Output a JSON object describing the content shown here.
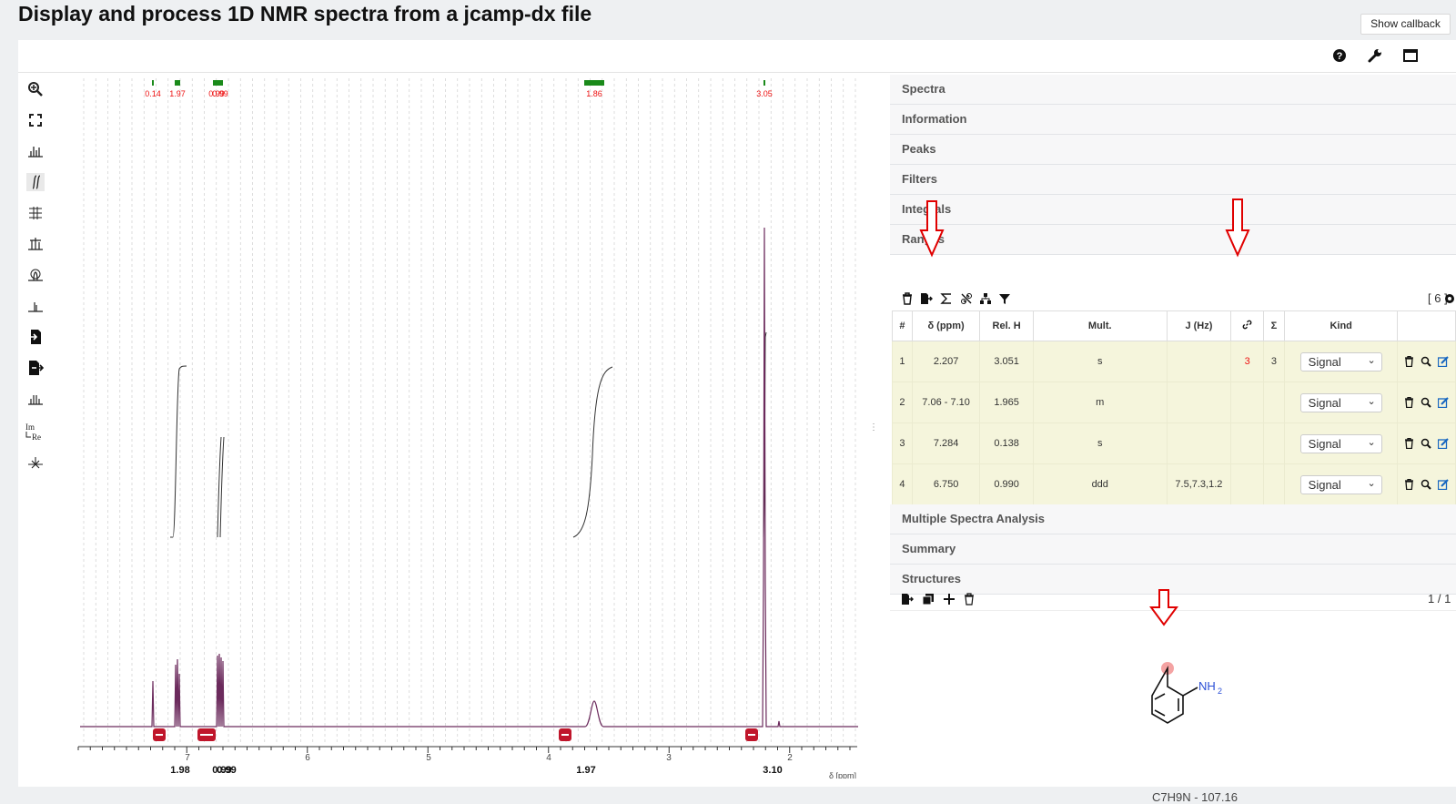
{
  "page": {
    "title": "Display and process 1D NMR spectra from a jcamp-dx file",
    "show_callback_label": "Show callback"
  },
  "topbar": {
    "icons": [
      "help-icon",
      "wrench-icon",
      "fullscreen-icon"
    ]
  },
  "toolbar": {
    "tools": [
      "zoom-tool",
      "full-zoom-tool",
      "peak-picking-tool",
      "integral-tool",
      "zone-tool",
      "ranges-picking-tool",
      "phase-correction-tool",
      "baseline-correction-tool",
      "import-tool",
      "export-tool",
      "multiplet-analysis-tool",
      "real-imaginary-tool",
      "exclusion-zones-tool"
    ]
  },
  "spectrum": {
    "x_axis_unit": "δ [ppm]",
    "ticks": [
      "7",
      "6",
      "5",
      "4",
      "3",
      "2"
    ],
    "integral_labels": [
      "0.14",
      "1.97",
      "0.99",
      "1.86",
      "3.05"
    ],
    "range_sums": [
      "1.98",
      "0.99",
      "1.97",
      "3.10"
    ]
  },
  "panels": {
    "spectra": "Spectra",
    "information": "Information",
    "peaks": "Peaks",
    "filters": "Filters",
    "integrals": "Integrals",
    "ranges": "Ranges",
    "multiple": "Multiple Spectra Analysis",
    "summary": "Summary",
    "structures": "Structures"
  },
  "ranges": {
    "count_label": "[ 6 ]",
    "columns": [
      "#",
      "δ (ppm)",
      "Rel. H",
      "Mult.",
      "J (Hz)",
      "link-icon",
      "Σ",
      "Kind"
    ],
    "rows": [
      {
        "index": "1",
        "delta": "2.207",
        "rel_h": "3.051",
        "mult": "s",
        "j": "",
        "link": "3",
        "sum": "3",
        "kind": "Signal"
      },
      {
        "index": "2",
        "delta": "7.06 - 7.10",
        "rel_h": "1.965",
        "mult": "m",
        "j": "",
        "link": "",
        "sum": "",
        "kind": "Signal"
      },
      {
        "index": "3",
        "delta": "7.284",
        "rel_h": "0.138",
        "mult": "s",
        "j": "",
        "link": "",
        "sum": "",
        "kind": "Signal"
      },
      {
        "index": "4",
        "delta": "6.750",
        "rel_h": "0.990",
        "mult": "ddd",
        "j": "7.5,7.3,1.2",
        "link": "",
        "sum": "",
        "kind": "Signal"
      }
    ]
  },
  "structures": {
    "pager": "1 / 1",
    "nh2_label": "NH",
    "nh2_sub": "2",
    "formula": "C7H9N - 107.16"
  },
  "colors": {
    "spectrum": "#6b2a5c",
    "integral_labels": "#e11",
    "integral_bars": "#1a8a1a",
    "range_row_bg": "#f5f5dc",
    "annotation_arrow": "#e00000",
    "delete_marker": "#c0162b"
  }
}
